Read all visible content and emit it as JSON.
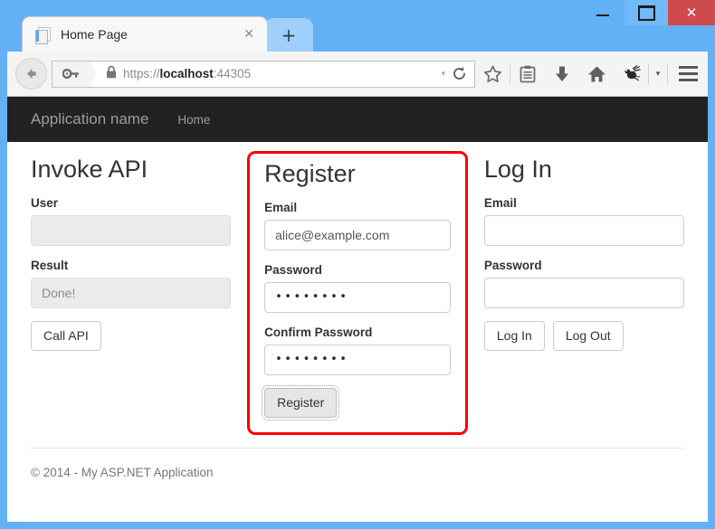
{
  "window": {
    "controls": {
      "minimize": "minimize",
      "maximize": "maximize",
      "close": "✕"
    }
  },
  "browser": {
    "tab": {
      "title": "Home Page",
      "favicon": "page-icon",
      "close_label": "✕"
    },
    "new_tab_label": "+",
    "toolbar": {
      "back_label": "back",
      "url_scheme": "https://",
      "url_host": "localhost",
      "url_rest": ":44305",
      "url_full": "https://localhost:44305",
      "dropdown_caret": "▾",
      "reload_label": "reload",
      "icons": [
        "bookmark-star-icon",
        "reading-list-icon",
        "download-icon",
        "home-icon",
        "firefox-hello-icon"
      ],
      "overflow_caret": "▾",
      "menu_label": "menu"
    }
  },
  "page": {
    "navbar": {
      "brand": "Application name",
      "links": [
        {
          "label": "Home"
        }
      ]
    },
    "columns": {
      "invoke": {
        "heading": "Invoke API",
        "user_label": "User",
        "user_value": "",
        "user_placeholder": "",
        "result_label": "Result",
        "result_value": "Done!",
        "call_button": "Call API"
      },
      "register": {
        "heading": "Register",
        "email_label": "Email",
        "email_value": "alice@example.com",
        "password_label": "Password",
        "password_value": "••••••••",
        "confirm_label": "Confirm Password",
        "confirm_value": "••••••••",
        "register_button": "Register",
        "highlight_color": "#fb0000"
      },
      "login": {
        "heading": "Log In",
        "email_label": "Email",
        "email_value": "",
        "password_label": "Password",
        "password_value": "",
        "login_button": "Log In",
        "logout_button": "Log Out"
      }
    },
    "footer": {
      "text": "© 2014 - My ASP.NET Application"
    }
  },
  "colors": {
    "title_bar": "#63b0f5",
    "close_button": "#cf4b4b",
    "navbar": "#222222",
    "highlight": "#fb0000"
  }
}
